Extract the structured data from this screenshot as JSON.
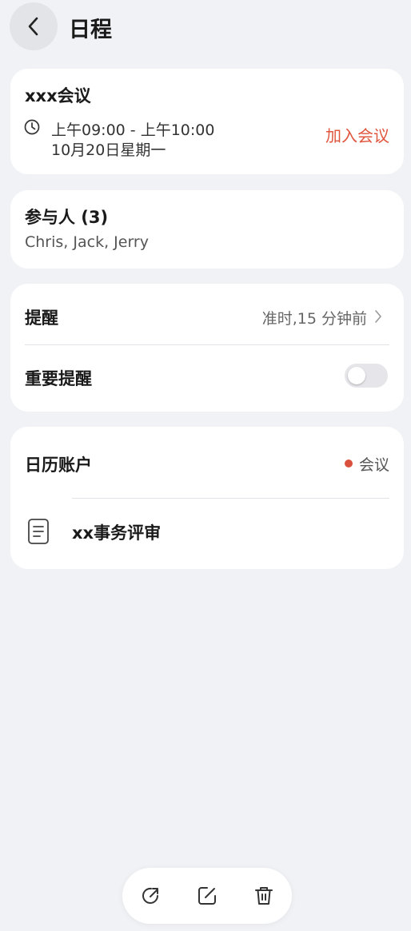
{
  "header": {
    "title": "日程",
    "back_icon": "chevron-left-icon"
  },
  "event": {
    "title": "xxx会议",
    "time_range": "上午09:00 - 上午10:00",
    "date": "10月20日星期一",
    "join_label": "加入会议",
    "join_color": "#e0553d"
  },
  "participants": {
    "title": "参与人 (3)",
    "names": "Chris, Jack, Jerry"
  },
  "reminder": {
    "label": "提醒",
    "value": "准时,15 分钟前",
    "important_label": "重要提醒",
    "important_enabled": false
  },
  "account": {
    "label": "日历账户",
    "name": "会议",
    "dot_color": "#d9503c"
  },
  "note": {
    "title": "xx事务评审",
    "icon": "document-icon"
  },
  "bottom_bar": {
    "actions": [
      {
        "icon": "share-icon"
      },
      {
        "icon": "edit-icon"
      },
      {
        "icon": "delete-icon"
      }
    ]
  }
}
